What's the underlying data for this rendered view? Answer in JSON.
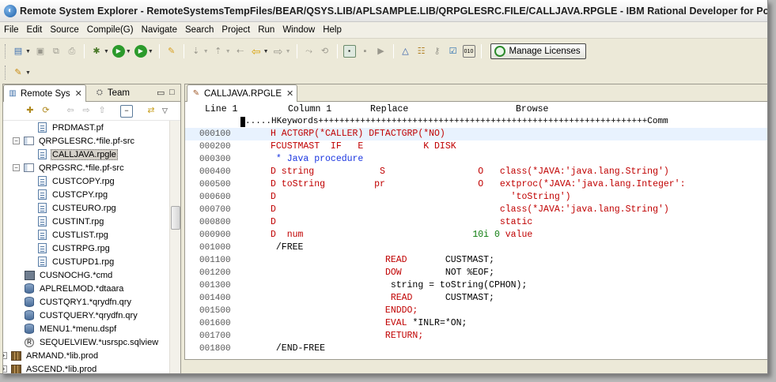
{
  "window": {
    "title": "Remote System Explorer - RemoteSystemsTempFiles/BEAR/QSYS.LIB/APLSAMPLE.LIB/QRPGLESRC.FILE/CALLJAVA.RPGLE - IBM Rational Developer for Power"
  },
  "menu": [
    "File",
    "Edit",
    "Source",
    "Compile(G)",
    "Navigate",
    "Search",
    "Project",
    "Run",
    "Window",
    "Help"
  ],
  "toolbar": {
    "manage_licenses_label": "Manage Licenses"
  },
  "left_panel": {
    "tabs": [
      {
        "label": "Remote Sys",
        "active": true
      },
      {
        "label": "Team",
        "active": false
      }
    ],
    "tree": [
      {
        "label": "PRDMAST.pf",
        "indent": 2,
        "icon": "member-icon",
        "expander": ""
      },
      {
        "label": "QRPGLESRC.*file.pf-src",
        "indent": 1,
        "icon": "source-file-icon",
        "expander": "−"
      },
      {
        "label": "CALLJAVA.rpgle",
        "indent": 2,
        "icon": "member-icon",
        "expander": "",
        "selected": true
      },
      {
        "label": "QRPGSRC.*file.pf-src",
        "indent": 1,
        "icon": "source-file-icon",
        "expander": "−"
      },
      {
        "label": "CUSTCOPY.rpg",
        "indent": 2,
        "icon": "member-icon",
        "expander": ""
      },
      {
        "label": "CUSTCPY.rpg",
        "indent": 2,
        "icon": "member-icon",
        "expander": ""
      },
      {
        "label": "CUSTEURO.rpg",
        "indent": 2,
        "icon": "member-icon",
        "expander": ""
      },
      {
        "label": "CUSTINT.rpg",
        "indent": 2,
        "icon": "member-icon",
        "expander": ""
      },
      {
        "label": "CUSTLIST.rpg",
        "indent": 2,
        "icon": "member-icon",
        "expander": ""
      },
      {
        "label": "CUSTRPG.rpg",
        "indent": 2,
        "icon": "member-icon",
        "expander": ""
      },
      {
        "label": "CUSTUPD1.rpg",
        "indent": 2,
        "icon": "member-icon",
        "expander": ""
      },
      {
        "label": "CUSNOCHG.*cmd",
        "indent": 1,
        "icon": "command-icon",
        "expander": ""
      },
      {
        "label": "APLRELMOD.*dtaara",
        "indent": 1,
        "icon": "data-area-icon",
        "expander": ""
      },
      {
        "label": "CUSTQRY1.*qrydfn.qry",
        "indent": 1,
        "icon": "query-icon",
        "expander": ""
      },
      {
        "label": "CUSTQUERY.*qrydfn.qry",
        "indent": 1,
        "icon": "query-icon",
        "expander": ""
      },
      {
        "label": "MENU1.*menu.dspf",
        "indent": 1,
        "icon": "menu-icon",
        "expander": ""
      },
      {
        "label": "SEQUELVIEW.*usrspc.sqlview",
        "indent": 1,
        "icon": "user-space-icon",
        "expander": ""
      },
      {
        "label": "ARMAND.*lib.prod",
        "indent": 0,
        "icon": "library-icon",
        "expander": "+"
      },
      {
        "label": "ASCEND.*lib.prod",
        "indent": 0,
        "icon": "library-icon",
        "expander": "+"
      }
    ]
  },
  "editor": {
    "tab_label": "CALLJAVA.RPGLE",
    "status": {
      "line_label": "Line 1",
      "column_label": "Column 1",
      "mode": "Replace",
      "access": "Browse"
    },
    "ruler": ".....HKeywords+++++++++++++++++++++++++++++++++++++++++++++++++++++++++++++++Comm",
    "lines": [
      {
        "seq": "000100",
        "parts": [
          {
            "t": "H ACTGRP(*CALLER) DFTACTGRP(*NO)",
            "c": "red"
          }
        ]
      },
      {
        "seq": "000200",
        "parts": [
          {
            "t": "FCUSTMAST  IF   E           K DISK",
            "c": "red"
          }
        ]
      },
      {
        "seq": "000300",
        "parts": [
          {
            "t": " * Java procedure",
            "c": "blue"
          }
        ]
      },
      {
        "seq": "000400",
        "parts": [
          {
            "t": "D string            S                 O   class(*JAVA:'java.lang.String')",
            "c": "red"
          }
        ]
      },
      {
        "seq": "000500",
        "parts": [
          {
            "t": "D toString         pr                 O   extproc(*JAVA:'java.lang.Integer':",
            "c": "red"
          }
        ]
      },
      {
        "seq": "000600",
        "parts": [
          {
            "t": "D                                           'toString')",
            "c": "red"
          }
        ]
      },
      {
        "seq": "000700",
        "parts": [
          {
            "t": "D                                         class(*JAVA:'java.lang.String')",
            "c": "red"
          }
        ]
      },
      {
        "seq": "000800",
        "parts": [
          {
            "t": "D                                         static",
            "c": "red"
          }
        ]
      },
      {
        "seq": "000900",
        "parts": [
          {
            "t": "D  num                               ",
            "c": "red"
          },
          {
            "t": "10i 0",
            "c": "green"
          },
          {
            "t": " value",
            "c": "red"
          }
        ]
      },
      {
        "seq": "001000",
        "parts": [
          {
            "t": " /FREE",
            "c": "black"
          }
        ]
      },
      {
        "seq": "001100",
        "parts": [
          {
            "t": "                     READ       CUSTMAST;",
            "c": "mixed-read"
          }
        ]
      },
      {
        "seq": "001200",
        "parts": [
          {
            "t": "                     DOW        NOT %EOF;",
            "c": "mixed-dow"
          }
        ]
      },
      {
        "seq": "001300",
        "parts": [
          {
            "t": "                      string = toString(CPHON);",
            "c": "black"
          }
        ]
      },
      {
        "seq": "001400",
        "parts": [
          {
            "t": "                      READ      CUSTMAST;",
            "c": "mixed-read2"
          }
        ]
      },
      {
        "seq": "001500",
        "parts": [
          {
            "t": "                     ENDDO;",
            "c": "red"
          }
        ]
      },
      {
        "seq": "001600",
        "parts": [
          {
            "t": "                     EVAL *INLR=*ON;",
            "c": "mixed-eval"
          }
        ]
      },
      {
        "seq": "001700",
        "parts": [
          {
            "t": "                     RETURN;",
            "c": "red"
          }
        ]
      },
      {
        "seq": "001800",
        "parts": [
          {
            "t": " /END-FREE",
            "c": "black"
          }
        ]
      }
    ]
  },
  "colors": {
    "keyword_red": "#c00000",
    "comment_blue": "#1a35e0",
    "numeric_green": "#0a7a0a",
    "current_line": "#e8f2fe"
  }
}
